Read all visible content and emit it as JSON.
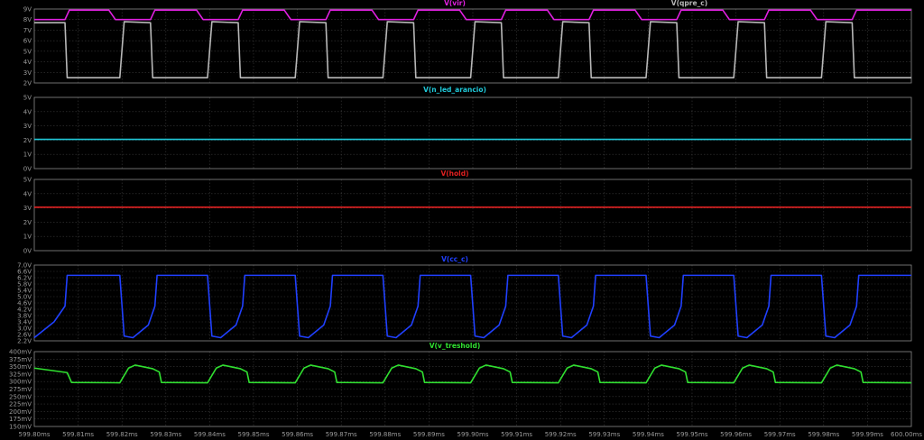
{
  "chart_data": {
    "type": "line",
    "x_ticks": [
      "599.80ms",
      "599.81ms",
      "599.82ms",
      "599.83ms",
      "599.84ms",
      "599.85ms",
      "599.86ms",
      "599.87ms",
      "599.88ms",
      "599.89ms",
      "599.90ms",
      "599.91ms",
      "599.92ms",
      "599.93ms",
      "599.94ms",
      "599.95ms",
      "599.96ms",
      "599.97ms",
      "599.98ms",
      "599.99ms",
      "600.00ms"
    ],
    "xlim": [
      599.8,
      600.0
    ],
    "x_unit": "ms",
    "panes": [
      {
        "ylim": [
          2,
          9
        ],
        "y_ticks": [
          "9V",
          "8V",
          "7V",
          "6V",
          "5V",
          "4V",
          "3V",
          "2V"
        ],
        "traces": [
          {
            "name": "V(vir)",
            "color": "#e020e0",
            "title_align": "center",
            "points": [
              [
                599.8,
                8.0
              ],
              [
                599.807,
                8.0
              ],
              [
                599.808,
                8.9
              ],
              [
                599.817,
                8.9
              ],
              [
                599.8185,
                8.0
              ],
              [
                599.8265,
                8.0
              ],
              [
                599.8275,
                8.9
              ],
              [
                599.837,
                8.9
              ],
              [
                599.8385,
                8.0
              ],
              [
                599.8465,
                8.0
              ],
              [
                599.8475,
                8.9
              ],
              [
                599.857,
                8.9
              ],
              [
                599.8585,
                8.0
              ],
              [
                599.8665,
                8.0
              ],
              [
                599.8675,
                8.9
              ],
              [
                599.877,
                8.9
              ],
              [
                599.8785,
                8.0
              ],
              [
                599.8865,
                8.0
              ],
              [
                599.8875,
                8.9
              ],
              [
                599.897,
                8.9
              ],
              [
                599.8985,
                8.0
              ],
              [
                599.9065,
                8.0
              ],
              [
                599.9075,
                8.9
              ],
              [
                599.917,
                8.9
              ],
              [
                599.9185,
                8.0
              ],
              [
                599.9265,
                8.0
              ],
              [
                599.9275,
                8.9
              ],
              [
                599.937,
                8.9
              ],
              [
                599.9385,
                8.0
              ],
              [
                599.9465,
                8.0
              ],
              [
                599.9475,
                8.9
              ],
              [
                599.957,
                8.9
              ],
              [
                599.9585,
                8.0
              ],
              [
                599.9665,
                8.0
              ],
              [
                599.9675,
                8.9
              ],
              [
                599.977,
                8.9
              ],
              [
                599.9785,
                8.0
              ],
              [
                599.9865,
                8.0
              ],
              [
                599.9875,
                8.9
              ],
              [
                600.0,
                8.9
              ]
            ]
          },
          {
            "name": "V(qpre_c)",
            "color": "#b8b8b8",
            "title_align": "right",
            "points": [
              [
                599.8,
                7.7
              ],
              [
                599.807,
                7.7
              ],
              [
                599.8075,
                2.5
              ],
              [
                599.8195,
                2.5
              ],
              [
                599.8205,
                7.8
              ],
              [
                599.8265,
                7.7
              ],
              [
                599.827,
                2.5
              ],
              [
                599.8395,
                2.5
              ],
              [
                599.8405,
                7.8
              ],
              [
                599.8465,
                7.7
              ],
              [
                599.847,
                2.5
              ],
              [
                599.8595,
                2.5
              ],
              [
                599.8605,
                7.8
              ],
              [
                599.8665,
                7.7
              ],
              [
                599.867,
                2.5
              ],
              [
                599.8795,
                2.5
              ],
              [
                599.8805,
                7.8
              ],
              [
                599.8865,
                7.7
              ],
              [
                599.887,
                2.5
              ],
              [
                599.8995,
                2.5
              ],
              [
                599.9005,
                7.8
              ],
              [
                599.9065,
                7.7
              ],
              [
                599.907,
                2.5
              ],
              [
                599.9195,
                2.5
              ],
              [
                599.9205,
                7.8
              ],
              [
                599.9265,
                7.7
              ],
              [
                599.927,
                2.5
              ],
              [
                599.9395,
                2.5
              ],
              [
                599.9405,
                7.8
              ],
              [
                599.9465,
                7.7
              ],
              [
                599.947,
                2.5
              ],
              [
                599.9595,
                2.5
              ],
              [
                599.9605,
                7.8
              ],
              [
                599.9665,
                7.7
              ],
              [
                599.967,
                2.5
              ],
              [
                599.9795,
                2.5
              ],
              [
                599.9805,
                7.8
              ],
              [
                599.9865,
                7.7
              ],
              [
                599.987,
                2.5
              ],
              [
                600.0,
                2.5
              ]
            ]
          }
        ]
      },
      {
        "ylim": [
          0,
          5
        ],
        "y_ticks": [
          "5V",
          "4V",
          "3V",
          "2V",
          "1V",
          "0V"
        ],
        "traces": [
          {
            "name": "V(n_led_arancio)",
            "color": "#20c8d8",
            "title_align": "center",
            "points": [
              [
                599.8,
                2.05
              ],
              [
                600.0,
                2.05
              ]
            ]
          }
        ]
      },
      {
        "ylim": [
          0,
          5
        ],
        "y_ticks": [
          "5V",
          "4V",
          "3V",
          "2V",
          "1V",
          "0V"
        ],
        "traces": [
          {
            "name": "V(hold)",
            "color": "#e02020",
            "title_align": "center",
            "points": [
              [
                599.8,
                3.05
              ],
              [
                600.0,
                3.05
              ]
            ]
          }
        ]
      },
      {
        "ylim": [
          2.2,
          7.0
        ],
        "y_ticks": [
          "7.0V",
          "6.6V",
          "6.2V",
          "5.8V",
          "5.4V",
          "5.0V",
          "4.6V",
          "4.2V",
          "3.8V",
          "3.4V",
          "3.0V",
          "2.6V",
          "2.2V"
        ],
        "traces": [
          {
            "name": "V(cc_c)",
            "color": "#2040ff",
            "title_align": "center",
            "points": [
              [
                599.8,
                2.4
              ],
              [
                599.8045,
                3.4
              ],
              [
                599.807,
                4.4
              ],
              [
                599.8075,
                6.35
              ],
              [
                599.8195,
                6.35
              ],
              [
                599.8205,
                2.5
              ],
              [
                599.8225,
                2.4
              ],
              [
                599.826,
                3.2
              ],
              [
                599.8275,
                4.4
              ],
              [
                599.828,
                6.35
              ],
              [
                599.8395,
                6.35
              ],
              [
                599.8405,
                2.5
              ],
              [
                599.8425,
                2.4
              ],
              [
                599.846,
                3.2
              ],
              [
                599.8475,
                4.4
              ],
              [
                599.848,
                6.35
              ],
              [
                599.8595,
                6.35
              ],
              [
                599.8605,
                2.5
              ],
              [
                599.8625,
                2.4
              ],
              [
                599.866,
                3.2
              ],
              [
                599.8675,
                4.4
              ],
              [
                599.868,
                6.35
              ],
              [
                599.8795,
                6.35
              ],
              [
                599.8805,
                2.5
              ],
              [
                599.8825,
                2.4
              ],
              [
                599.886,
                3.2
              ],
              [
                599.8875,
                4.4
              ],
              [
                599.888,
                6.35
              ],
              [
                599.8995,
                6.35
              ],
              [
                599.9005,
                2.5
              ],
              [
                599.9025,
                2.4
              ],
              [
                599.906,
                3.2
              ],
              [
                599.9075,
                4.4
              ],
              [
                599.908,
                6.35
              ],
              [
                599.9195,
                6.35
              ],
              [
                599.9205,
                2.5
              ],
              [
                599.9225,
                2.4
              ],
              [
                599.926,
                3.2
              ],
              [
                599.9275,
                4.4
              ],
              [
                599.928,
                6.35
              ],
              [
                599.9395,
                6.35
              ],
              [
                599.9405,
                2.5
              ],
              [
                599.9425,
                2.4
              ],
              [
                599.946,
                3.2
              ],
              [
                599.9475,
                4.4
              ],
              [
                599.948,
                6.35
              ],
              [
                599.9595,
                6.35
              ],
              [
                599.9605,
                2.5
              ],
              [
                599.9625,
                2.4
              ],
              [
                599.966,
                3.2
              ],
              [
                599.9675,
                4.4
              ],
              [
                599.968,
                6.35
              ],
              [
                599.9795,
                6.35
              ],
              [
                599.9805,
                2.5
              ],
              [
                599.9825,
                2.4
              ],
              [
                599.986,
                3.2
              ],
              [
                599.9875,
                4.4
              ],
              [
                599.988,
                6.35
              ],
              [
                600.0,
                6.35
              ]
            ]
          }
        ]
      },
      {
        "ylim": [
          150,
          400
        ],
        "y_ticks": [
          "400mV",
          "375mV",
          "350mV",
          "325mV",
          "300mV",
          "275mV",
          "250mV",
          "225mV",
          "200mV",
          "175mV",
          "150mV"
        ],
        "traces": [
          {
            "name": "V(v_treshold)",
            "color": "#30e030",
            "title_align": "center",
            "points": [
              [
                599.8,
                345
              ],
              [
                599.8075,
                330
              ],
              [
                599.8085,
                297
              ],
              [
                599.8195,
                296
              ],
              [
                599.8215,
                345
              ],
              [
                599.823,
                355
              ],
              [
                599.827,
                343
              ],
              [
                599.8285,
                332
              ],
              [
                599.829,
                297
              ],
              [
                599.8395,
                296
              ],
              [
                599.8415,
                345
              ],
              [
                599.843,
                355
              ],
              [
                599.847,
                343
              ],
              [
                599.8485,
                332
              ],
              [
                599.849,
                297
              ],
              [
                599.8595,
                296
              ],
              [
                599.8615,
                345
              ],
              [
                599.863,
                355
              ],
              [
                599.867,
                343
              ],
              [
                599.8685,
                332
              ],
              [
                599.869,
                297
              ],
              [
                599.8795,
                296
              ],
              [
                599.8815,
                345
              ],
              [
                599.883,
                355
              ],
              [
                599.887,
                343
              ],
              [
                599.8885,
                332
              ],
              [
                599.889,
                297
              ],
              [
                599.8995,
                296
              ],
              [
                599.9015,
                345
              ],
              [
                599.903,
                355
              ],
              [
                599.907,
                343
              ],
              [
                599.9085,
                332
              ],
              [
                599.909,
                297
              ],
              [
                599.9195,
                296
              ],
              [
                599.9215,
                345
              ],
              [
                599.923,
                355
              ],
              [
                599.927,
                343
              ],
              [
                599.9285,
                332
              ],
              [
                599.929,
                297
              ],
              [
                599.9395,
                296
              ],
              [
                599.9415,
                345
              ],
              [
                599.943,
                355
              ],
              [
                599.947,
                343
              ],
              [
                599.9485,
                332
              ],
              [
                599.949,
                297
              ],
              [
                599.9595,
                296
              ],
              [
                599.9615,
                345
              ],
              [
                599.963,
                355
              ],
              [
                599.967,
                343
              ],
              [
                599.9685,
                332
              ],
              [
                599.969,
                297
              ],
              [
                599.9795,
                296
              ],
              [
                599.9815,
                345
              ],
              [
                599.983,
                355
              ],
              [
                599.987,
                343
              ],
              [
                599.9885,
                332
              ],
              [
                599.989,
                297
              ],
              [
                600.0,
                296
              ]
            ]
          }
        ]
      }
    ]
  }
}
